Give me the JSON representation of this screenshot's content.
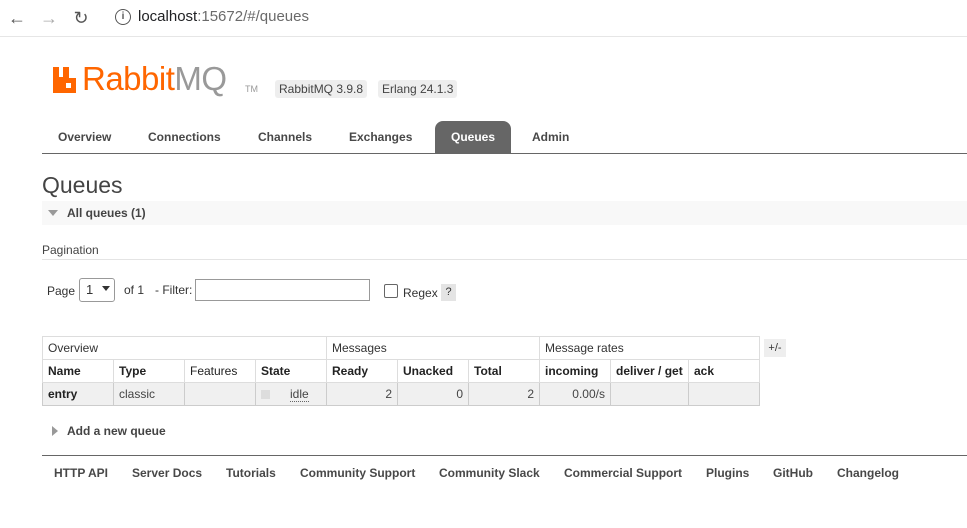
{
  "browser": {
    "url_host": "localhost",
    "url_rest": ":15672/#/queues"
  },
  "header": {
    "logo_rabbit": "Rabbit",
    "logo_mq": "MQ",
    "logo_tm": "TM",
    "version": "RabbitMQ 3.9.8",
    "erlang": "Erlang 24.1.3"
  },
  "tabs": [
    {
      "label": "Overview"
    },
    {
      "label": "Connections"
    },
    {
      "label": "Channels"
    },
    {
      "label": "Exchanges"
    },
    {
      "label": "Queues",
      "active": true
    },
    {
      "label": "Admin"
    }
  ],
  "page": {
    "title": "Queues",
    "section": "All queues (1)"
  },
  "pagination": {
    "label": "Pagination",
    "page_label": "Page",
    "page_value": "1",
    "of_label": "of 1",
    "filter_label": "- Filter:",
    "filter_value": "",
    "regex_label": "Regex",
    "help": "?"
  },
  "table": {
    "groups": [
      "Overview",
      "Messages",
      "Message rates"
    ],
    "columns": [
      "Name",
      "Type",
      "Features",
      "State",
      "Ready",
      "Unacked",
      "Total",
      "incoming",
      "deliver / get",
      "ack"
    ],
    "toggle": "+/-",
    "rows": [
      {
        "name": "entry",
        "type": "classic",
        "features": "",
        "state": "idle",
        "ready": "2",
        "unacked": "0",
        "total": "2",
        "incoming": "0.00/s",
        "deliver_get": "",
        "ack": ""
      }
    ]
  },
  "add_queue": "Add a new queue",
  "footer": [
    "HTTP API",
    "Server Docs",
    "Tutorials",
    "Community Support",
    "Community Slack",
    "Commercial Support",
    "Plugins",
    "GitHub",
    "Changelog"
  ],
  "colors": {
    "brand": "#ff6600",
    "tab_active": "#666666"
  }
}
